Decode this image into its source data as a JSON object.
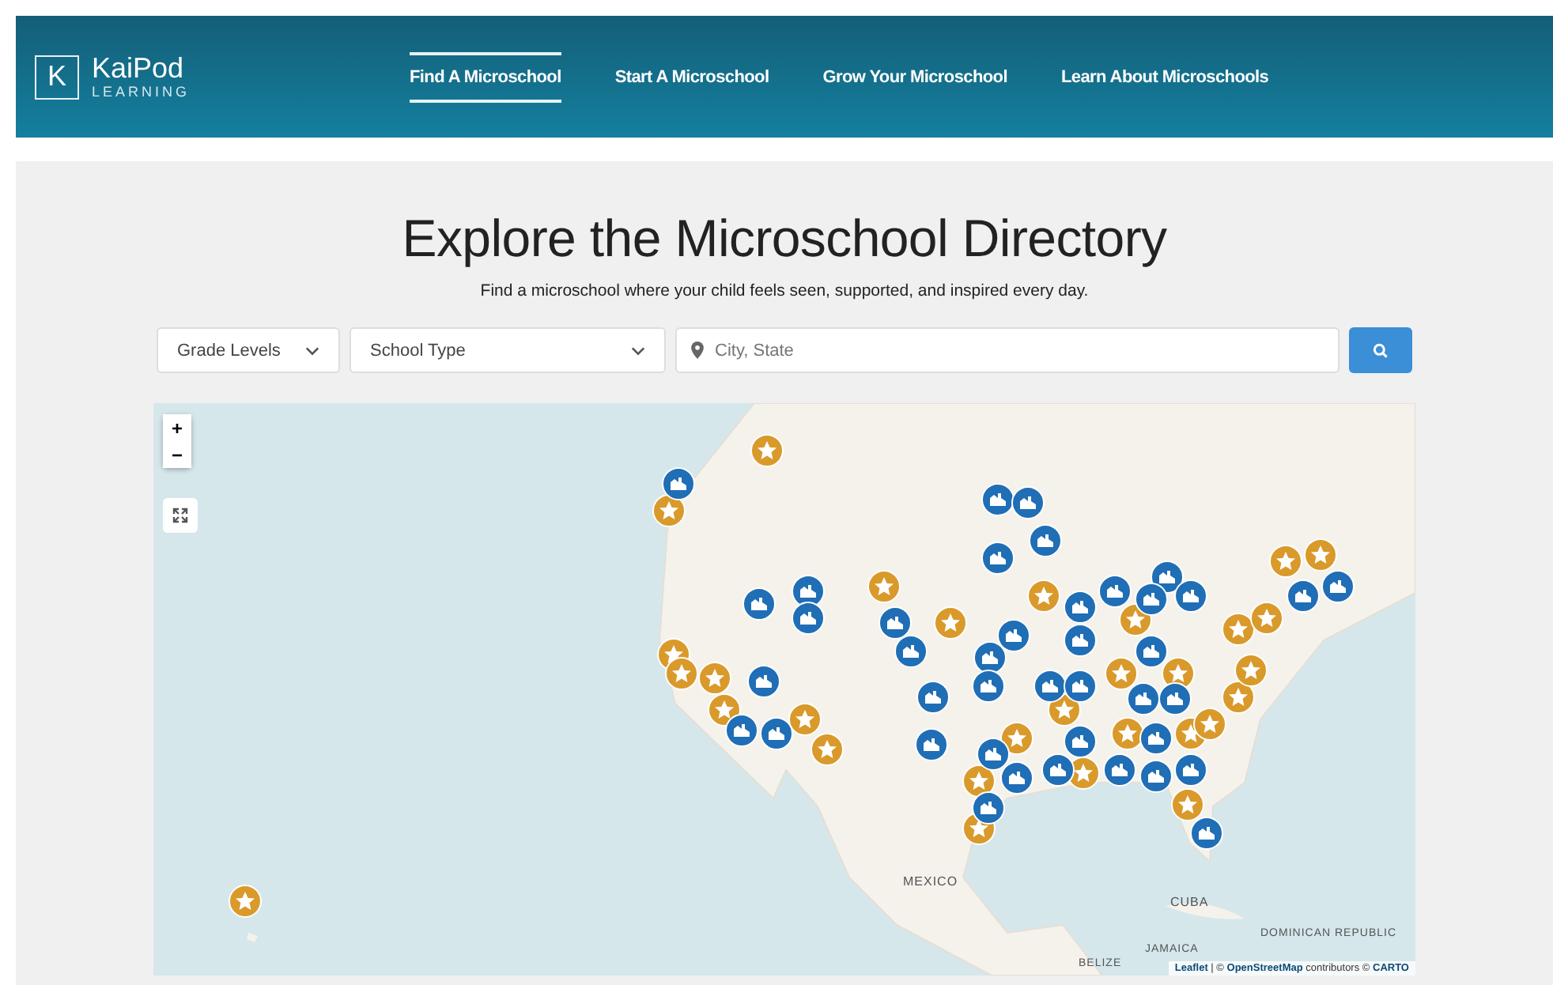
{
  "header": {
    "logo": {
      "letter": "K",
      "name": "KaiPod",
      "sub": "LEARNING"
    },
    "nav": [
      {
        "label": "Find A Microschool",
        "selected": true
      },
      {
        "label": "Start A Microschool",
        "selected": false
      },
      {
        "label": "Grow Your Microschool",
        "selected": false
      },
      {
        "label": "Learn About Microschools",
        "selected": false
      }
    ]
  },
  "hero": {
    "title": "Explore the Microschool Directory",
    "subtitle": "Find a microschool where your child feels seen, supported, and inspired every day."
  },
  "filters": {
    "grade": "Grade Levels",
    "school_type": "School Type",
    "location": {
      "placeholder": "City, State"
    }
  },
  "map": {
    "zoom_in": "+",
    "zoom_out": "−",
    "labels": [
      {
        "text": "MEXICO"
      },
      {
        "text": "CUBA"
      },
      {
        "text": "DOMINICAN REPUBLIC"
      },
      {
        "text": "JAMAICA"
      },
      {
        "text": "BELIZE"
      }
    ],
    "attribution": {
      "links": [
        "Leaflet",
        "OpenStreetMap"
      ],
      "text_1": " | © ",
      "text_2": " contributors © ",
      "last_link": "CARTO"
    }
  }
}
